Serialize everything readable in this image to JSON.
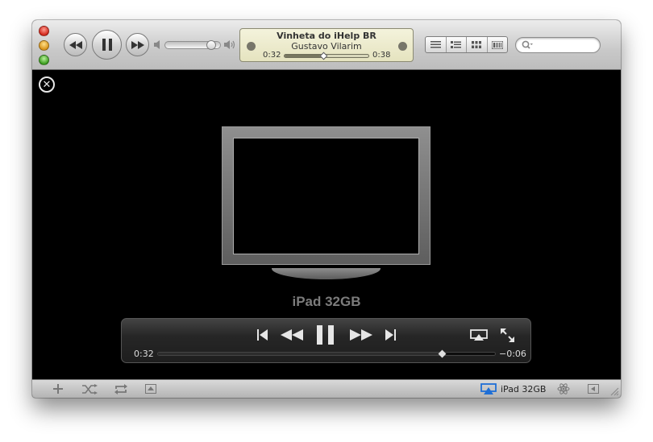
{
  "toolbar": {
    "now_playing": {
      "title": "Vinheta do iHelp BR",
      "artist": "Gustavo Vilarim",
      "elapsed": "0:32",
      "remaining": "0:38",
      "progress": 0.46
    },
    "volume": 0.88,
    "search": {
      "placeholder": ""
    }
  },
  "airplay_screen": {
    "device_name": "iPad 32GB",
    "hud": {
      "elapsed": "0:32",
      "remaining": "−0:06",
      "progress": 0.84
    }
  },
  "bottom_bar": {
    "airplay_device": "iPad 32GB"
  },
  "colors": {
    "airplay_accent": "#1f6fd6",
    "lcd_background": "#ecebcf"
  }
}
